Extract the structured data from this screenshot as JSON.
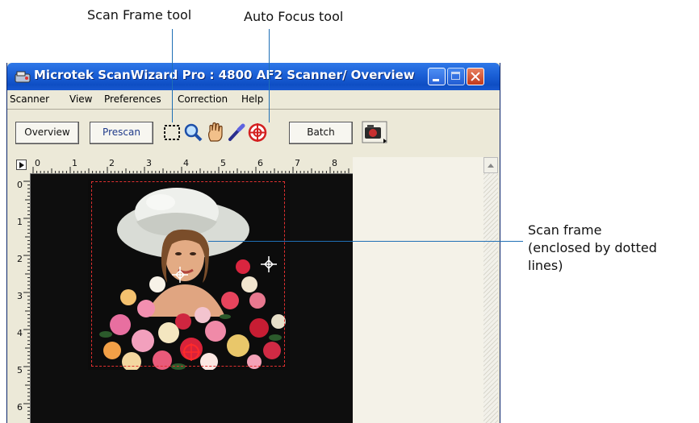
{
  "callouts": {
    "scan_frame_tool": "Scan Frame tool",
    "auto_focus_tool": "Auto Focus tool",
    "scan_frame_line1": "Scan frame",
    "scan_frame_line2": "(enclosed by dotted",
    "scan_frame_line3": "lines)"
  },
  "window": {
    "title": "Microtek ScanWizard Pro : 4800 AF2 Scanner/ Overview"
  },
  "menu": {
    "items": [
      "Scanner",
      "View",
      "Preferences",
      "Correction",
      "Help"
    ]
  },
  "toolbar": {
    "overview_label": "Overview",
    "prescan_label": "Prescan",
    "batch_label": "Batch",
    "tools": [
      "scan-frame-icon",
      "zoom-icon",
      "hand-icon",
      "eyedropper-icon",
      "auto-focus-icon",
      "camera-menu-icon"
    ]
  },
  "rulers": {
    "top": [
      "0",
      "1",
      "2",
      "3",
      "4",
      "5",
      "6",
      "7",
      "8"
    ],
    "left": [
      "0",
      "1",
      "2",
      "3",
      "4",
      "5",
      "6"
    ]
  },
  "colors": {
    "title_bar": "#1a5fd6",
    "callout_line": "#1f6fb5",
    "scan_frame_border": "#e03030"
  }
}
